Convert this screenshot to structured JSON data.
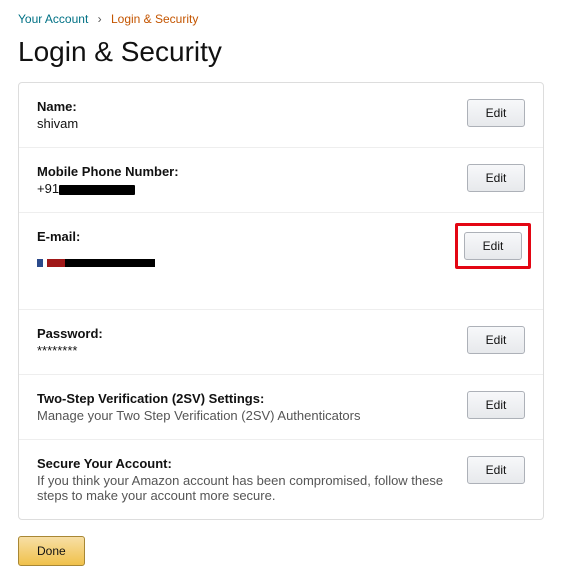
{
  "breadcrumb": {
    "root": "Your Account",
    "sep": "›",
    "current": "Login & Security"
  },
  "page_title": "Login & Security",
  "rows": {
    "name": {
      "label": "Name:",
      "value": "shivam",
      "edit": "Edit"
    },
    "mobile": {
      "label": "Mobile Phone Number:",
      "prefix": "+91",
      "edit": "Edit"
    },
    "email": {
      "label": "E-mail:",
      "edit": "Edit"
    },
    "password": {
      "label": "Password:",
      "value": "********",
      "edit": "Edit"
    },
    "tsv": {
      "label": "Two-Step Verification (2SV) Settings:",
      "desc": "Manage your Two Step Verification (2SV) Authenticators",
      "edit": "Edit"
    },
    "secure": {
      "label": "Secure Your Account:",
      "desc": "If you think your Amazon account has been compromised, follow these steps to make your account more secure.",
      "edit": "Edit"
    }
  },
  "done_label": "Done"
}
